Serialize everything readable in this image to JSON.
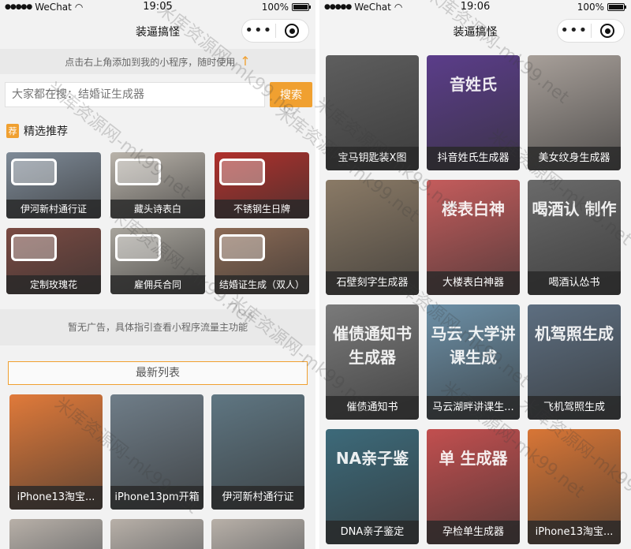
{
  "left": {
    "status": {
      "carrier": "WeChat",
      "time": "19:05",
      "battery": "100%"
    },
    "nav_title": "装逼搞怪",
    "tip": "点击右上角添加到我的小程序，随时使用",
    "search_placeholder": "大家都在搜：结婚证生成器",
    "search_button": "搜索",
    "section_badge": "荐",
    "section_title": "精选推荐",
    "featured": [
      {
        "label": "伊河新村通行证",
        "color": "#7e8a97"
      },
      {
        "label": "藏头诗表白",
        "color": "#b9b3aa"
      },
      {
        "label": "不锈钢生日牌",
        "color": "#b0302c"
      },
      {
        "label": "定制玫瑰花",
        "color": "#7a4a42"
      },
      {
        "label": "雇佣兵合同",
        "color": "#a8a49c"
      },
      {
        "label": "结婚证生成（双人）",
        "color": "#8b6a55"
      }
    ],
    "ad_text": "暂无广告，具体指引查看小程序流量主功能",
    "latest_title": "最新列表",
    "latest": [
      {
        "label": "iPhone13淘宝...",
        "color": "#e07a3a"
      },
      {
        "label": "iPhone13pm开箱",
        "color": "#6f7d88"
      },
      {
        "label": "伊河新村通行证",
        "color": "#5f7682"
      }
    ]
  },
  "right": {
    "status": {
      "carrier": "WeChat",
      "time": "19:06",
      "battery": "100%"
    },
    "nav_title": "装逼搞怪",
    "items": [
      {
        "label": "宝马钥匙装X图",
        "color": "#5e5e5e",
        "art": ""
      },
      {
        "label": "抖音姓氏生成器",
        "color": "#5b3d8a",
        "art": "音姓氏"
      },
      {
        "label": "美女纹身生成器",
        "color": "#a79f99",
        "art": ""
      },
      {
        "label": "石壁刻字生成器",
        "color": "#8a7a66",
        "art": ""
      },
      {
        "label": "大楼表白神器",
        "color": "#c45c5c",
        "art": "楼表白神"
      },
      {
        "label": "喝酒认怂书",
        "color": "#6a6a6a",
        "art": "喝酒认 制作"
      },
      {
        "label": "催债通知书",
        "color": "#7a7a7a",
        "art": "催债通知书 生成器"
      },
      {
        "label": "马云湖畔讲课生...",
        "color": "#6c8fa6",
        "art": "马云 大学讲课生成"
      },
      {
        "label": "飞机驾照生成",
        "color": "#5d6e80",
        "art": "机驾照生成"
      },
      {
        "label": "DNA亲子鉴定",
        "color": "#3d6a7a",
        "art": "NA亲子鉴"
      },
      {
        "label": "孕检单生成器",
        "color": "#c24f4f",
        "art": "单 生成器"
      },
      {
        "label": "iPhone13淘宝...",
        "color": "#d87636",
        "art": ""
      }
    ]
  },
  "watermark": "米库资源网-mk99.net"
}
